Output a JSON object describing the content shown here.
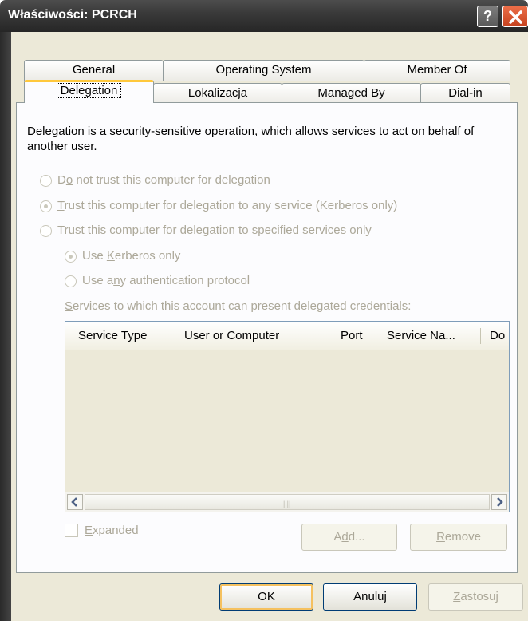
{
  "window": {
    "title": "Właściwości: PCRCH"
  },
  "tabs_row1": [
    "General",
    "Operating System",
    "Member Of"
  ],
  "tabs_row2": [
    "Delegation",
    "Lokalizacja",
    "Managed By",
    "Dial-in"
  ],
  "active_tab": "Delegation",
  "description": "Delegation is a security-sensitive operation, which allows services to act on behalf of another user.",
  "options": {
    "do_not_trust": {
      "pre": "D",
      "key": "o",
      "post": " not trust this computer for delegation",
      "selected": false
    },
    "trust_any": {
      "pre": "",
      "key": "T",
      "post": "rust this computer for delegation to any service (Kerberos only)",
      "selected": true
    },
    "trust_specified": {
      "pre": "Tr",
      "key": "u",
      "post": "st this computer for delegation to specified services only",
      "selected": false
    },
    "use_kerberos": {
      "pre": "Use ",
      "key": "K",
      "post": "erberos only",
      "selected": true
    },
    "use_any_auth": {
      "pre": "Use a",
      "key": "n",
      "post": "y authentication protocol",
      "selected": false
    }
  },
  "services_label": {
    "key": "S",
    "post": "ervices to which this account can present delegated credentials:"
  },
  "listview": {
    "columns": [
      "Service Type",
      "User or Computer",
      "Port",
      "Service Na...",
      "Do"
    ],
    "rows": []
  },
  "expanded": {
    "key": "E",
    "post": "xpanded",
    "checked": false
  },
  "buttons": {
    "add": {
      "pre": "A",
      "key": "d",
      "post": "d..."
    },
    "remove": {
      "pre": "",
      "key": "R",
      "post": "emove"
    },
    "ok": "OK",
    "cancel": "Anuluj",
    "apply": {
      "pre": "",
      "key": "Z",
      "post": "astosuj"
    }
  },
  "icons": {
    "help": "help-icon",
    "close": "close-icon",
    "scroll_left": "arrow-left-icon",
    "scroll_right": "arrow-right-icon"
  }
}
